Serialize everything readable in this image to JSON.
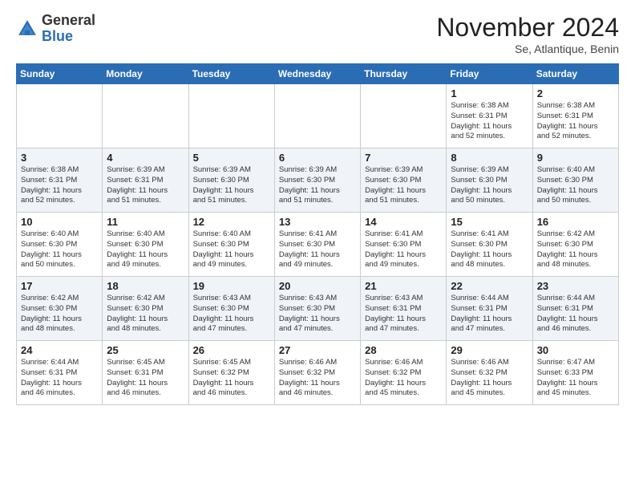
{
  "logo": {
    "general": "General",
    "blue": "Blue"
  },
  "header": {
    "month": "November 2024",
    "location": "Se, Atlantique, Benin"
  },
  "weekdays": [
    "Sunday",
    "Monday",
    "Tuesday",
    "Wednesday",
    "Thursday",
    "Friday",
    "Saturday"
  ],
  "weeks": [
    [
      {
        "day": "",
        "info": ""
      },
      {
        "day": "",
        "info": ""
      },
      {
        "day": "",
        "info": ""
      },
      {
        "day": "",
        "info": ""
      },
      {
        "day": "",
        "info": ""
      },
      {
        "day": "1",
        "info": "Sunrise: 6:38 AM\nSunset: 6:31 PM\nDaylight: 11 hours\nand 52 minutes."
      },
      {
        "day": "2",
        "info": "Sunrise: 6:38 AM\nSunset: 6:31 PM\nDaylight: 11 hours\nand 52 minutes."
      }
    ],
    [
      {
        "day": "3",
        "info": "Sunrise: 6:38 AM\nSunset: 6:31 PM\nDaylight: 11 hours\nand 52 minutes."
      },
      {
        "day": "4",
        "info": "Sunrise: 6:39 AM\nSunset: 6:31 PM\nDaylight: 11 hours\nand 51 minutes."
      },
      {
        "day": "5",
        "info": "Sunrise: 6:39 AM\nSunset: 6:30 PM\nDaylight: 11 hours\nand 51 minutes."
      },
      {
        "day": "6",
        "info": "Sunrise: 6:39 AM\nSunset: 6:30 PM\nDaylight: 11 hours\nand 51 minutes."
      },
      {
        "day": "7",
        "info": "Sunrise: 6:39 AM\nSunset: 6:30 PM\nDaylight: 11 hours\nand 51 minutes."
      },
      {
        "day": "8",
        "info": "Sunrise: 6:39 AM\nSunset: 6:30 PM\nDaylight: 11 hours\nand 50 minutes."
      },
      {
        "day": "9",
        "info": "Sunrise: 6:40 AM\nSunset: 6:30 PM\nDaylight: 11 hours\nand 50 minutes."
      }
    ],
    [
      {
        "day": "10",
        "info": "Sunrise: 6:40 AM\nSunset: 6:30 PM\nDaylight: 11 hours\nand 50 minutes."
      },
      {
        "day": "11",
        "info": "Sunrise: 6:40 AM\nSunset: 6:30 PM\nDaylight: 11 hours\nand 49 minutes."
      },
      {
        "day": "12",
        "info": "Sunrise: 6:40 AM\nSunset: 6:30 PM\nDaylight: 11 hours\nand 49 minutes."
      },
      {
        "day": "13",
        "info": "Sunrise: 6:41 AM\nSunset: 6:30 PM\nDaylight: 11 hours\nand 49 minutes."
      },
      {
        "day": "14",
        "info": "Sunrise: 6:41 AM\nSunset: 6:30 PM\nDaylight: 11 hours\nand 49 minutes."
      },
      {
        "day": "15",
        "info": "Sunrise: 6:41 AM\nSunset: 6:30 PM\nDaylight: 11 hours\nand 48 minutes."
      },
      {
        "day": "16",
        "info": "Sunrise: 6:42 AM\nSunset: 6:30 PM\nDaylight: 11 hours\nand 48 minutes."
      }
    ],
    [
      {
        "day": "17",
        "info": "Sunrise: 6:42 AM\nSunset: 6:30 PM\nDaylight: 11 hours\nand 48 minutes."
      },
      {
        "day": "18",
        "info": "Sunrise: 6:42 AM\nSunset: 6:30 PM\nDaylight: 11 hours\nand 48 minutes."
      },
      {
        "day": "19",
        "info": "Sunrise: 6:43 AM\nSunset: 6:30 PM\nDaylight: 11 hours\nand 47 minutes."
      },
      {
        "day": "20",
        "info": "Sunrise: 6:43 AM\nSunset: 6:30 PM\nDaylight: 11 hours\nand 47 minutes."
      },
      {
        "day": "21",
        "info": "Sunrise: 6:43 AM\nSunset: 6:31 PM\nDaylight: 11 hours\nand 47 minutes."
      },
      {
        "day": "22",
        "info": "Sunrise: 6:44 AM\nSunset: 6:31 PM\nDaylight: 11 hours\nand 47 minutes."
      },
      {
        "day": "23",
        "info": "Sunrise: 6:44 AM\nSunset: 6:31 PM\nDaylight: 11 hours\nand 46 minutes."
      }
    ],
    [
      {
        "day": "24",
        "info": "Sunrise: 6:44 AM\nSunset: 6:31 PM\nDaylight: 11 hours\nand 46 minutes."
      },
      {
        "day": "25",
        "info": "Sunrise: 6:45 AM\nSunset: 6:31 PM\nDaylight: 11 hours\nand 46 minutes."
      },
      {
        "day": "26",
        "info": "Sunrise: 6:45 AM\nSunset: 6:32 PM\nDaylight: 11 hours\nand 46 minutes."
      },
      {
        "day": "27",
        "info": "Sunrise: 6:46 AM\nSunset: 6:32 PM\nDaylight: 11 hours\nand 46 minutes."
      },
      {
        "day": "28",
        "info": "Sunrise: 6:46 AM\nSunset: 6:32 PM\nDaylight: 11 hours\nand 45 minutes."
      },
      {
        "day": "29",
        "info": "Sunrise: 6:46 AM\nSunset: 6:32 PM\nDaylight: 11 hours\nand 45 minutes."
      },
      {
        "day": "30",
        "info": "Sunrise: 6:47 AM\nSunset: 6:33 PM\nDaylight: 11 hours\nand 45 minutes."
      }
    ]
  ]
}
